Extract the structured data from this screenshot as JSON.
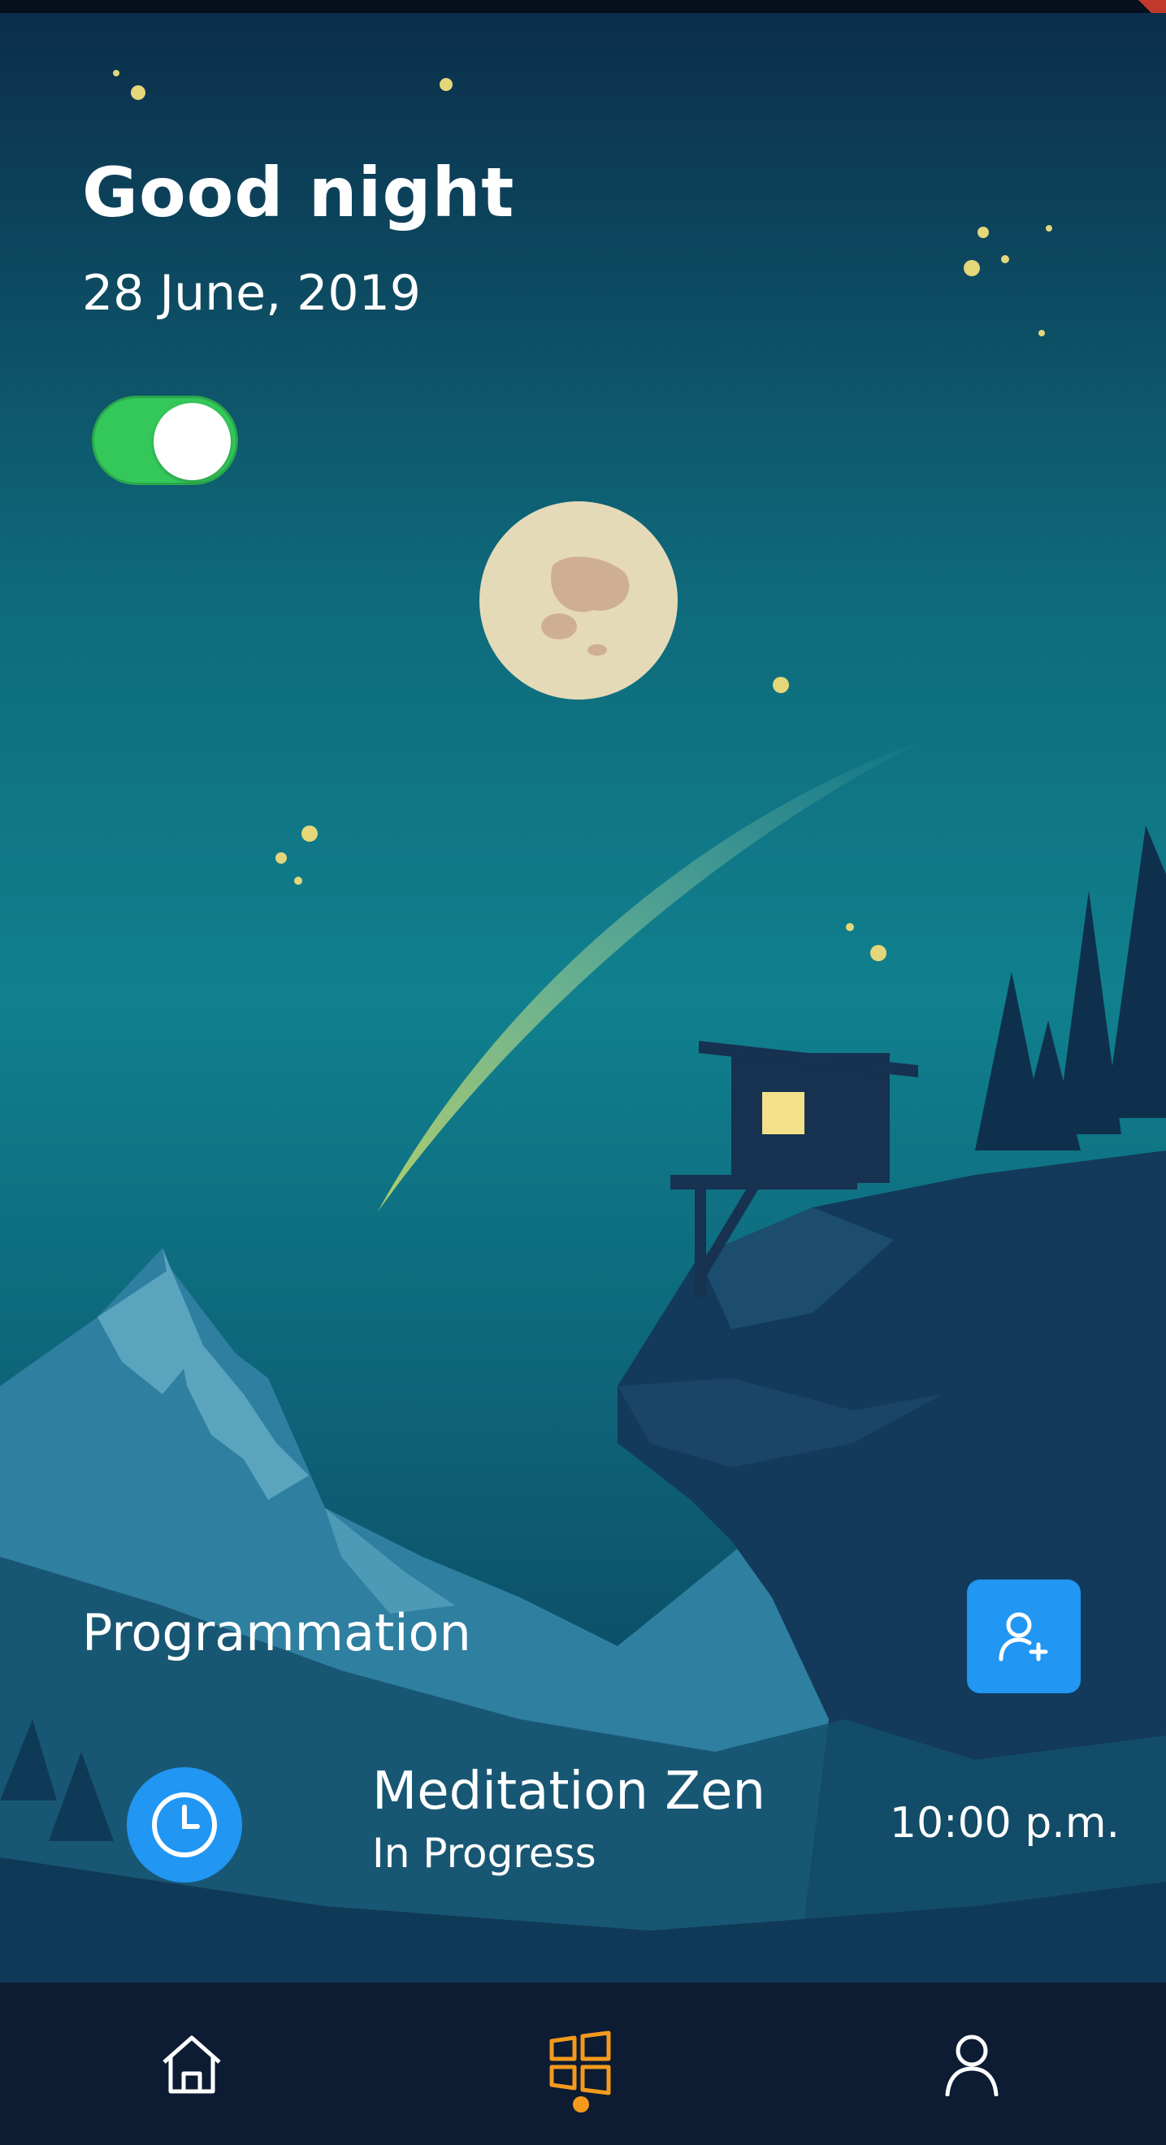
{
  "header": {
    "greeting": "Good night",
    "date": "28 June, 2019"
  },
  "night_mode_toggle": {
    "state": "on",
    "color": "#34c85a"
  },
  "programmation": {
    "title": "Programmation",
    "add_button_icon": "add-user-icon",
    "accent_color": "#2196f3"
  },
  "tasks": [
    {
      "title": "Meditation Zen",
      "status": "In Progress",
      "time": "10:00 p.m.",
      "icon": "clock-icon"
    }
  ],
  "bottom_nav": {
    "items": [
      {
        "icon": "home-icon",
        "active": false
      },
      {
        "icon": "dashboard-icon",
        "active": true
      },
      {
        "icon": "profile-icon",
        "active": false
      }
    ],
    "active_color": "#f39a1d",
    "background": "#0d1b33"
  }
}
